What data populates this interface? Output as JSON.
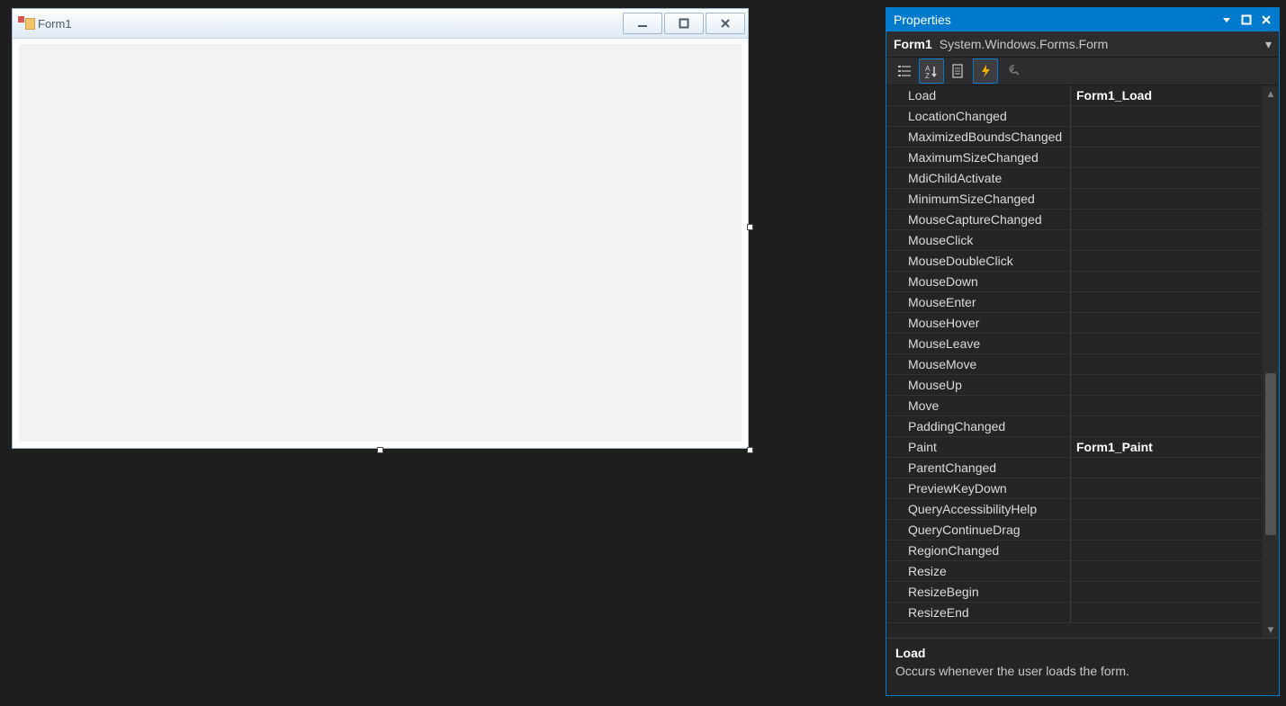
{
  "designer": {
    "form_title": "Form1"
  },
  "properties": {
    "panel_title": "Properties",
    "object_name": "Form1",
    "object_type": "System.Windows.Forms.Form",
    "events": [
      {
        "name": "Load",
        "value": "Form1_Load",
        "bold": true
      },
      {
        "name": "LocationChanged",
        "value": ""
      },
      {
        "name": "MaximizedBoundsChanged",
        "value": ""
      },
      {
        "name": "MaximumSizeChanged",
        "value": ""
      },
      {
        "name": "MdiChildActivate",
        "value": ""
      },
      {
        "name": "MinimumSizeChanged",
        "value": ""
      },
      {
        "name": "MouseCaptureChanged",
        "value": ""
      },
      {
        "name": "MouseClick",
        "value": ""
      },
      {
        "name": "MouseDoubleClick",
        "value": ""
      },
      {
        "name": "MouseDown",
        "value": ""
      },
      {
        "name": "MouseEnter",
        "value": ""
      },
      {
        "name": "MouseHover",
        "value": ""
      },
      {
        "name": "MouseLeave",
        "value": ""
      },
      {
        "name": "MouseMove",
        "value": ""
      },
      {
        "name": "MouseUp",
        "value": ""
      },
      {
        "name": "Move",
        "value": ""
      },
      {
        "name": "PaddingChanged",
        "value": ""
      },
      {
        "name": "Paint",
        "value": "Form1_Paint",
        "bold": true
      },
      {
        "name": "ParentChanged",
        "value": ""
      },
      {
        "name": "PreviewKeyDown",
        "value": ""
      },
      {
        "name": "QueryAccessibilityHelp",
        "value": ""
      },
      {
        "name": "QueryContinueDrag",
        "value": ""
      },
      {
        "name": "RegionChanged",
        "value": ""
      },
      {
        "name": "Resize",
        "value": ""
      },
      {
        "name": "ResizeBegin",
        "value": ""
      },
      {
        "name": "ResizeEnd",
        "value": ""
      }
    ],
    "description": {
      "name": "Load",
      "text": "Occurs whenever the user loads the form."
    }
  }
}
